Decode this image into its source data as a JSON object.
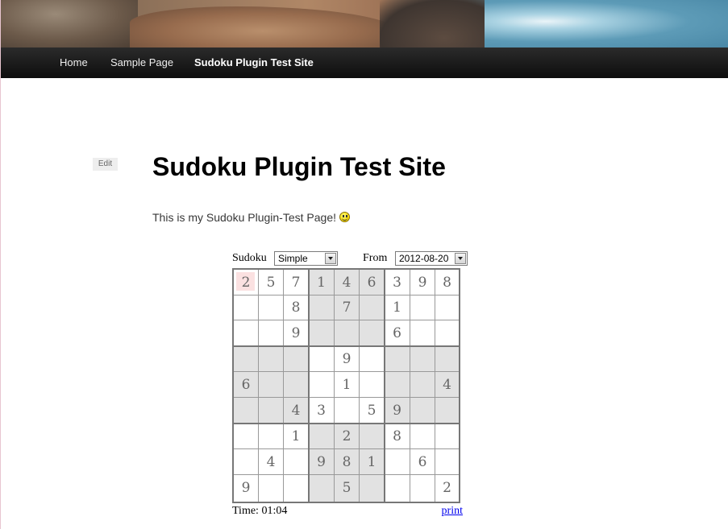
{
  "nav": {
    "items": [
      {
        "label": "Home"
      },
      {
        "label": "Sample Page"
      },
      {
        "label": "Sudoku Plugin Test Site"
      }
    ]
  },
  "article": {
    "edit_label": "Edit",
    "title": "Sudoku Plugin Test Site",
    "intro_text": "This is my Sudoku Plugin-Test Page!",
    "emoji_icon": "smiley-icon"
  },
  "sudoku": {
    "label": "Sudoku",
    "difficulty_selected": "Simple",
    "from_label": "From",
    "date_selected": "2012-08-20",
    "selected_cell": {
      "row": 0,
      "col": 0
    },
    "highlight_color": "#fbe1e1",
    "shade_color": "#e2e2e2",
    "grid": [
      [
        "2",
        "5",
        "7",
        "1",
        "4",
        "6",
        "3",
        "9",
        "8"
      ],
      [
        "",
        "",
        "8",
        "",
        "7",
        "",
        "1",
        "",
        ""
      ],
      [
        "",
        "",
        "9",
        "",
        "",
        "",
        "6",
        "",
        ""
      ],
      [
        "",
        "",
        "",
        "",
        "9",
        "",
        "",
        "",
        ""
      ],
      [
        "6",
        "",
        "",
        "",
        "1",
        "",
        "",
        "",
        "4"
      ],
      [
        "",
        "",
        "4",
        "3",
        "",
        "5",
        "9",
        "",
        ""
      ],
      [
        "",
        "",
        "1",
        "",
        "2",
        "",
        "8",
        "",
        ""
      ],
      [
        "",
        "4",
        "",
        "9",
        "8",
        "1",
        "",
        "6",
        ""
      ],
      [
        "9",
        "",
        "",
        "",
        "5",
        "",
        "",
        "",
        "2"
      ]
    ],
    "timer_text": "Time: 01:04",
    "print_label": "print"
  },
  "colors": {
    "navbar": "#1a1a1a",
    "link": "#0000ee"
  }
}
